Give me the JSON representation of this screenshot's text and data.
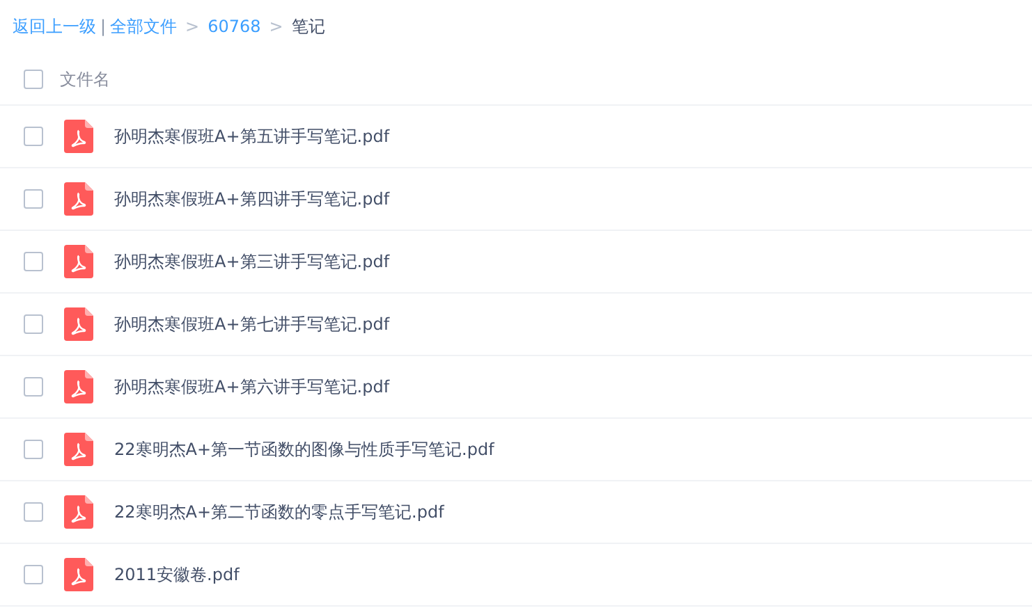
{
  "breadcrumb": [
    {
      "kind": "link",
      "text": "返回上一级"
    },
    {
      "kind": "divider",
      "text": "|"
    },
    {
      "kind": "link",
      "text": "全部文件"
    },
    {
      "kind": "separator",
      "text": ">"
    },
    {
      "kind": "link",
      "text": "60768"
    },
    {
      "kind": "separator",
      "text": ">"
    },
    {
      "kind": "current",
      "text": "笔记"
    }
  ],
  "table": {
    "header": {
      "checked": false,
      "label": "文件名"
    },
    "rows": [
      {
        "checked": false,
        "name": "孙明杰寒假班A+第五讲手写笔记.pdf"
      },
      {
        "checked": false,
        "name": "孙明杰寒假班A+第四讲手写笔记.pdf"
      },
      {
        "checked": false,
        "name": "孙明杰寒假班A+第三讲手写笔记.pdf"
      },
      {
        "checked": false,
        "name": "孙明杰寒假班A+第七讲手写笔记.pdf"
      },
      {
        "checked": false,
        "name": "孙明杰寒假班A+第六讲手写笔记.pdf"
      },
      {
        "checked": false,
        "name": "22寒明杰A+第一节函数的图像与性质手写笔记.pdf"
      },
      {
        "checked": false,
        "name": "22寒明杰A+第二节函数的零点手写笔记.pdf"
      },
      {
        "checked": false,
        "name": "2011安徽卷.pdf"
      }
    ]
  }
}
